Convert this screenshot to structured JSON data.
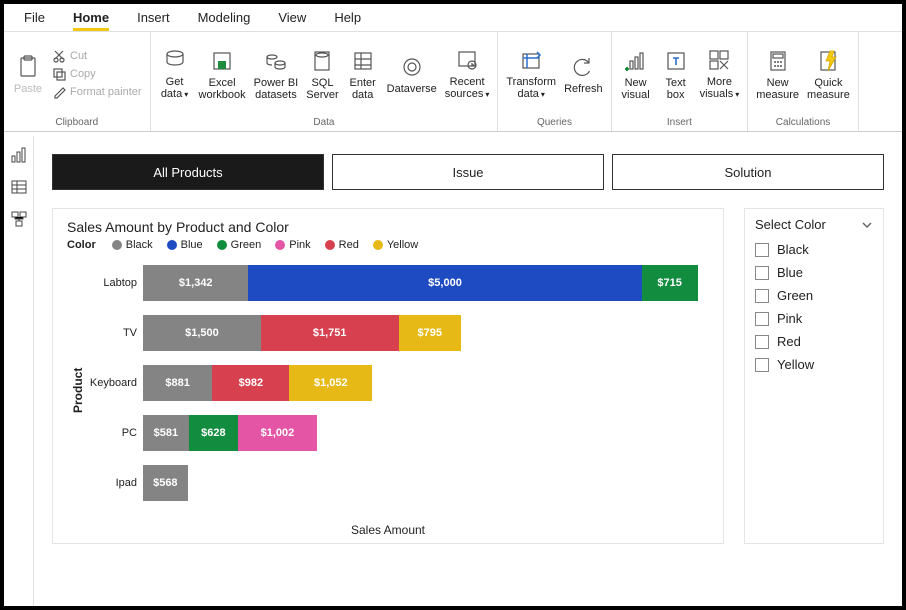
{
  "menubar": {
    "items": [
      "File",
      "Home",
      "Insert",
      "Modeling",
      "View",
      "Help"
    ],
    "active": 1
  },
  "ribbon": {
    "groups": [
      {
        "label": "Clipboard",
        "buttons": [
          {
            "name": "paste-button",
            "label": "Paste",
            "icon": "paste-icon",
            "dim": true,
            "drop": false
          }
        ],
        "mini": [
          {
            "name": "cut-button",
            "label": "Cut",
            "icon": "cut-icon"
          },
          {
            "name": "copy-button",
            "label": "Copy",
            "icon": "copy-icon"
          },
          {
            "name": "format-painter-button",
            "label": "Format painter",
            "icon": "brush-icon"
          }
        ]
      },
      {
        "label": "Data",
        "buttons": [
          {
            "name": "get-data-button",
            "label": "Get\ndata",
            "icon": "getdata-icon",
            "drop": true
          },
          {
            "name": "excel-workbook-button",
            "label": "Excel\nworkbook",
            "icon": "excel-icon"
          },
          {
            "name": "powerbi-datasets-button",
            "label": "Power BI\ndatasets",
            "icon": "dataset-icon"
          },
          {
            "name": "sql-server-button",
            "label": "SQL\nServer",
            "icon": "sql-icon"
          },
          {
            "name": "enter-data-button",
            "label": "Enter\ndata",
            "icon": "enterdata-icon"
          },
          {
            "name": "dataverse-button",
            "label": "Dataverse",
            "icon": "dataverse-icon"
          },
          {
            "name": "recent-sources-button",
            "label": "Recent\nsources",
            "icon": "recent-icon",
            "drop": true
          }
        ]
      },
      {
        "label": "Queries",
        "buttons": [
          {
            "name": "transform-data-button",
            "label": "Transform\ndata",
            "icon": "transform-icon",
            "drop": true
          },
          {
            "name": "refresh-button",
            "label": "Refresh",
            "icon": "refresh-icon"
          }
        ]
      },
      {
        "label": "Insert",
        "buttons": [
          {
            "name": "new-visual-button",
            "label": "New\nvisual",
            "icon": "newvisual-icon"
          },
          {
            "name": "text-box-button",
            "label": "Text\nbox",
            "icon": "textbox-icon"
          },
          {
            "name": "more-visuals-button",
            "label": "More\nvisuals",
            "icon": "morevisuals-icon",
            "drop": true
          }
        ]
      },
      {
        "label": "Calculations",
        "buttons": [
          {
            "name": "new-measure-button",
            "label": "New\nmeasure",
            "icon": "calculator-icon"
          },
          {
            "name": "quick-measure-button",
            "label": "Quick\nmeasure",
            "icon": "quickmeasure-icon"
          }
        ]
      }
    ]
  },
  "leftnav": {
    "items": [
      {
        "name": "report-view-icon",
        "icon": "report"
      },
      {
        "name": "data-view-icon",
        "icon": "table"
      },
      {
        "name": "model-view-icon",
        "icon": "model"
      }
    ]
  },
  "report_tabs": {
    "items": [
      "All Products",
      "Issue",
      "Solution"
    ],
    "active": 0
  },
  "chart": {
    "title": "Sales Amount by Product and Color",
    "legend_label": "Color",
    "x_axis": "Sales Amount",
    "y_axis": "Product"
  },
  "slicer": {
    "title": "Select Color",
    "items": [
      "Black",
      "Blue",
      "Green",
      "Pink",
      "Red",
      "Yellow"
    ]
  },
  "colors": {
    "Black": "#848484",
    "Blue": "#1f4bc2",
    "Green": "#128c3f",
    "Pink": "#e455a6",
    "Red": "#d6404f",
    "Yellow": "#e6b917"
  },
  "chart_data": {
    "type": "bar",
    "orientation": "horizontal",
    "stacked": true,
    "title": "Sales Amount by Product and Color",
    "xlabel": "Sales Amount",
    "ylabel": "Product",
    "legend_title": "Color",
    "xlim": [
      0,
      7200
    ],
    "categories": [
      "Labtop",
      "TV",
      "Keyboard",
      "PC",
      "Ipad"
    ],
    "series": [
      {
        "name": "Black",
        "color": "#848484",
        "values": [
          1342,
          1500,
          881,
          581,
          568
        ]
      },
      {
        "name": "Blue",
        "color": "#1f4bc2",
        "values": [
          5000,
          null,
          null,
          null,
          null
        ]
      },
      {
        "name": "Green",
        "color": "#128c3f",
        "values": [
          715,
          null,
          null,
          628,
          null
        ]
      },
      {
        "name": "Pink",
        "color": "#e455a6",
        "values": [
          null,
          null,
          null,
          1002,
          null
        ]
      },
      {
        "name": "Red",
        "color": "#d6404f",
        "values": [
          null,
          1751,
          982,
          null,
          null
        ]
      },
      {
        "name": "Yellow",
        "color": "#e6b917",
        "values": [
          null,
          795,
          1052,
          null,
          null
        ]
      }
    ],
    "display": [
      {
        "cat": "Labtop",
        "segs": [
          {
            "c": "Black",
            "v": 1342,
            "lbl": "$1,342"
          },
          {
            "c": "Blue",
            "v": 5000,
            "lbl": "$5,000"
          },
          {
            "c": "Green",
            "v": 715,
            "lbl": "$715"
          }
        ]
      },
      {
        "cat": "TV",
        "segs": [
          {
            "c": "Black",
            "v": 1500,
            "lbl": "$1,500"
          },
          {
            "c": "Red",
            "v": 1751,
            "lbl": "$1,751"
          },
          {
            "c": "Yellow",
            "v": 795,
            "lbl": "$795"
          }
        ]
      },
      {
        "cat": "Keyboard",
        "segs": [
          {
            "c": "Black",
            "v": 881,
            "lbl": "$881"
          },
          {
            "c": "Red",
            "v": 982,
            "lbl": "$982"
          },
          {
            "c": "Yellow",
            "v": 1052,
            "lbl": "$1,052"
          }
        ]
      },
      {
        "cat": "PC",
        "segs": [
          {
            "c": "Black",
            "v": 581,
            "lbl": "$581"
          },
          {
            "c": "Green",
            "v": 628,
            "lbl": "$628"
          },
          {
            "c": "Pink",
            "v": 1002,
            "lbl": "$1,002"
          }
        ]
      },
      {
        "cat": "Ipad",
        "segs": [
          {
            "c": "Black",
            "v": 568,
            "lbl": "$568"
          }
        ]
      }
    ]
  }
}
